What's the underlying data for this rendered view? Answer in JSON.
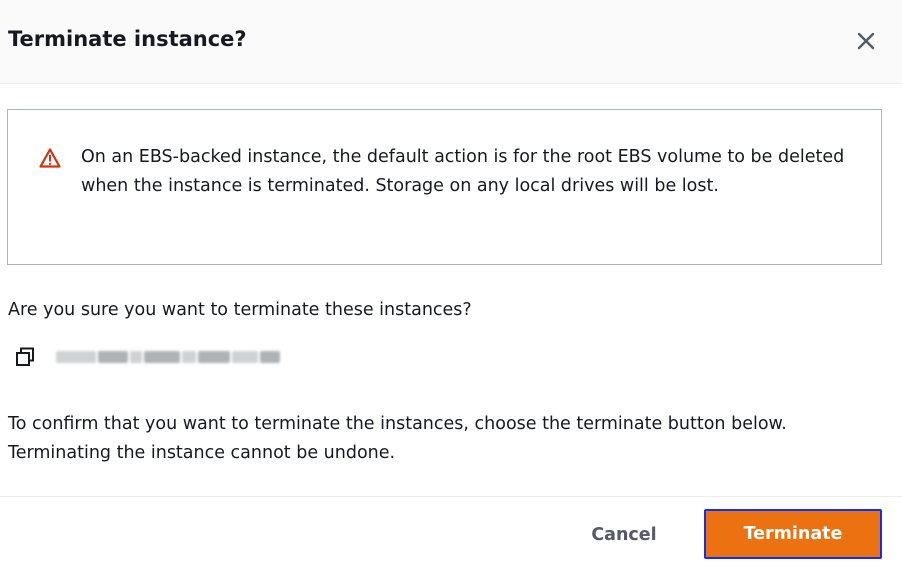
{
  "dialog": {
    "title": "Terminate instance?",
    "close_icon": "close-icon"
  },
  "alert": {
    "icon": "warning-triangle-icon",
    "icon_color": "#d13212",
    "message": "On an EBS-backed instance, the default action is for the root EBS volume to be deleted when the instance is terminated. Storage on any local drives will be lost."
  },
  "question": "Are you sure you want to terminate these instances?",
  "instance": {
    "copy_icon": "copy-icon",
    "id_redacted": true
  },
  "confirm_text": "To confirm that you want to terminate the instances, choose the terminate button below. Terminating the instance cannot be undone.",
  "footer": {
    "cancel_label": "Cancel",
    "terminate_label": "Terminate"
  },
  "colors": {
    "primary_button": "#ec7211",
    "focus_outline": "#0a2fff",
    "text": "#16191f",
    "muted_text": "#545b64",
    "border": "#aab7b8",
    "header_bg": "#fafafa"
  }
}
